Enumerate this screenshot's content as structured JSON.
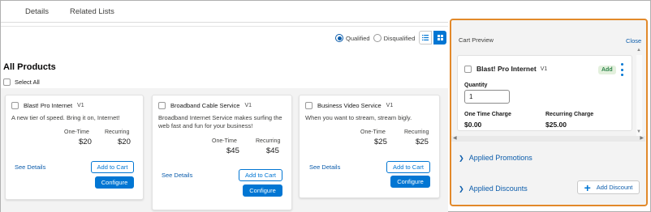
{
  "tabs": {
    "details": "Details",
    "related": "Related Lists"
  },
  "filters": {
    "qualified": "Qualified",
    "disqualified": "Disqualified"
  },
  "catalog": {
    "heading": "All Products",
    "select_all": "Select All"
  },
  "products": [
    {
      "name": "Blast! Pro Internet",
      "version": "V1",
      "description": "A new tier of speed. Bring it on, Internet!",
      "one_time_label": "One-Time",
      "one_time": "$20",
      "recurring_label": "Recurring",
      "recurring": "$20",
      "see_details": "See Details",
      "add_to_cart": "Add to Cart",
      "configure": "Configure"
    },
    {
      "name": "Broadband Cable Service",
      "version": "V1",
      "description": "Broadband Internet Service makes surfing the web fast and fun for your business!",
      "one_time_label": "One-Time",
      "one_time": "$45",
      "recurring_label": "Recurring",
      "recurring": "$45",
      "see_details": "See Details",
      "add_to_cart": "Add to Cart",
      "configure": "Configure"
    },
    {
      "name": "Business Video Service",
      "version": "V1",
      "description": "When you want to stream, stream bigly.",
      "one_time_label": "One-Time",
      "one_time": "$25",
      "recurring_label": "Recurring",
      "recurring": "$25",
      "see_details": "See Details",
      "add_to_cart": "Add to Cart",
      "configure": "Configure"
    }
  ],
  "cart": {
    "title": "Cart Preview",
    "close": "Close",
    "item": {
      "name": "Blast! Pro Internet",
      "version": "V1",
      "badge": "Add",
      "quantity_label": "Quantity",
      "quantity": "1",
      "one_time_label": "One Time Charge",
      "one_time": "$0.00",
      "recurring_label": "Recurring Charge",
      "recurring": "$25.00"
    },
    "applied_promotions": "Applied Promotions",
    "applied_discounts": "Applied Discounts",
    "add_discount": "Add Discount"
  },
  "colors": {
    "brand": "#0176d3",
    "link": "#0b5cab",
    "highlight_border": "#e2892a",
    "badge_bg": "#e3f0dd",
    "badge_text": "#2e844a"
  },
  "icons": [
    "chevron-right-icon",
    "plus-icon",
    "kebab-menu-icon",
    "list-view-icon",
    "grid-view-icon"
  ]
}
